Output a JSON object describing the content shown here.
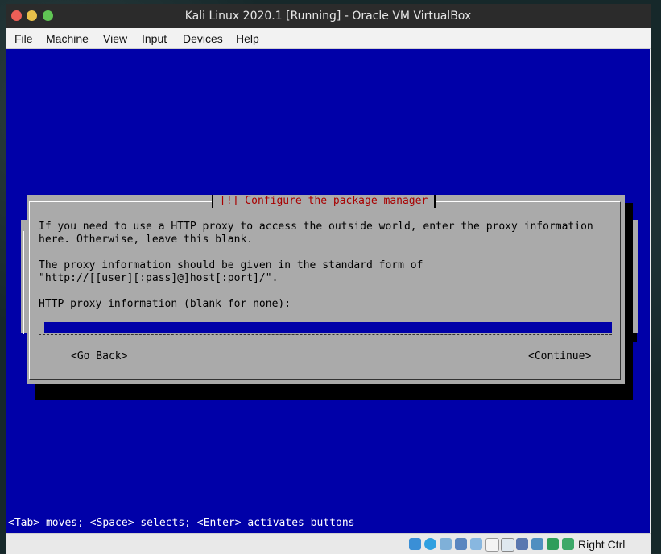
{
  "window": {
    "title": "Kali Linux 2020.1 [Running] - Oracle VM VirtualBox"
  },
  "menubar": {
    "items": [
      "File",
      "Machine",
      "View",
      "Input",
      "Devices",
      "Help"
    ]
  },
  "dialog": {
    "title": "[!] Configure the package manager",
    "line1": "If you need to use a HTTP proxy to access the outside world, enter the proxy information",
    "line2": "here. Otherwise, leave this blank.",
    "line3": "The proxy information should be given in the standard form of",
    "line4": "\"http://[[user][:pass]@]host[:port]/\".",
    "field_label": "HTTP proxy information (blank for none):",
    "proxy_value": "",
    "go_back": "<Go Back>",
    "continue": "<Continue>"
  },
  "help_line": "<Tab> moves; <Space> selects; <Enter> activates buttons",
  "statusbar": {
    "host_key": "Right Ctrl",
    "icons": [
      "hard-disk-icon",
      "optical-drive-icon",
      "audio-icon",
      "network-icon",
      "usb-icon",
      "shared-folders-icon",
      "display-icon",
      "video-capture-icon",
      "cpu-icon",
      "mouse-integration-icon"
    ]
  },
  "colors": {
    "vm_background": "#0000a8",
    "dialog_background": "#aaaaaa",
    "dialog_title": "#a80000",
    "input_background": "#0000a8"
  }
}
